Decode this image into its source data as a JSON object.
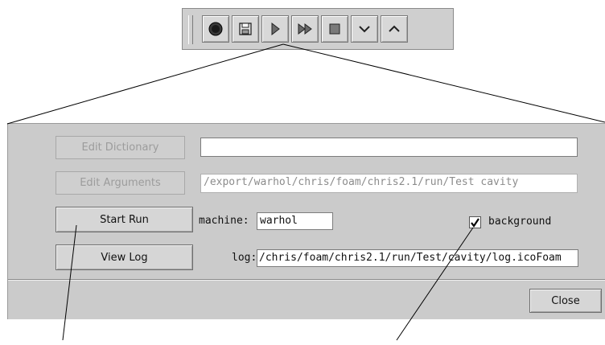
{
  "toolbar": {
    "buttons": [
      {
        "icon": "record-icon"
      },
      {
        "icon": "save-icon"
      },
      {
        "icon": "play-icon"
      },
      {
        "icon": "fast-forward-icon"
      },
      {
        "icon": "stop-icon"
      },
      {
        "icon": "chevron-down-icon"
      },
      {
        "icon": "chevron-up-icon"
      }
    ]
  },
  "dialog": {
    "edit_dictionary_label": "Edit Dictionary",
    "dictionary_value": "",
    "edit_arguments_label": "Edit Arguments",
    "arguments_value": "/export/warhol/chris/foam/chris2.1/run/Test cavity",
    "start_run_label": "Start Run",
    "machine_label": "machine:",
    "machine_value": "warhol",
    "background_label": "background",
    "background_checked": true,
    "view_log_label": "View Log",
    "log_label": "log:",
    "log_value": "/chris/foam/chris2.1/run/Test/cavity/log.icoFoam",
    "close_label": "Close"
  }
}
